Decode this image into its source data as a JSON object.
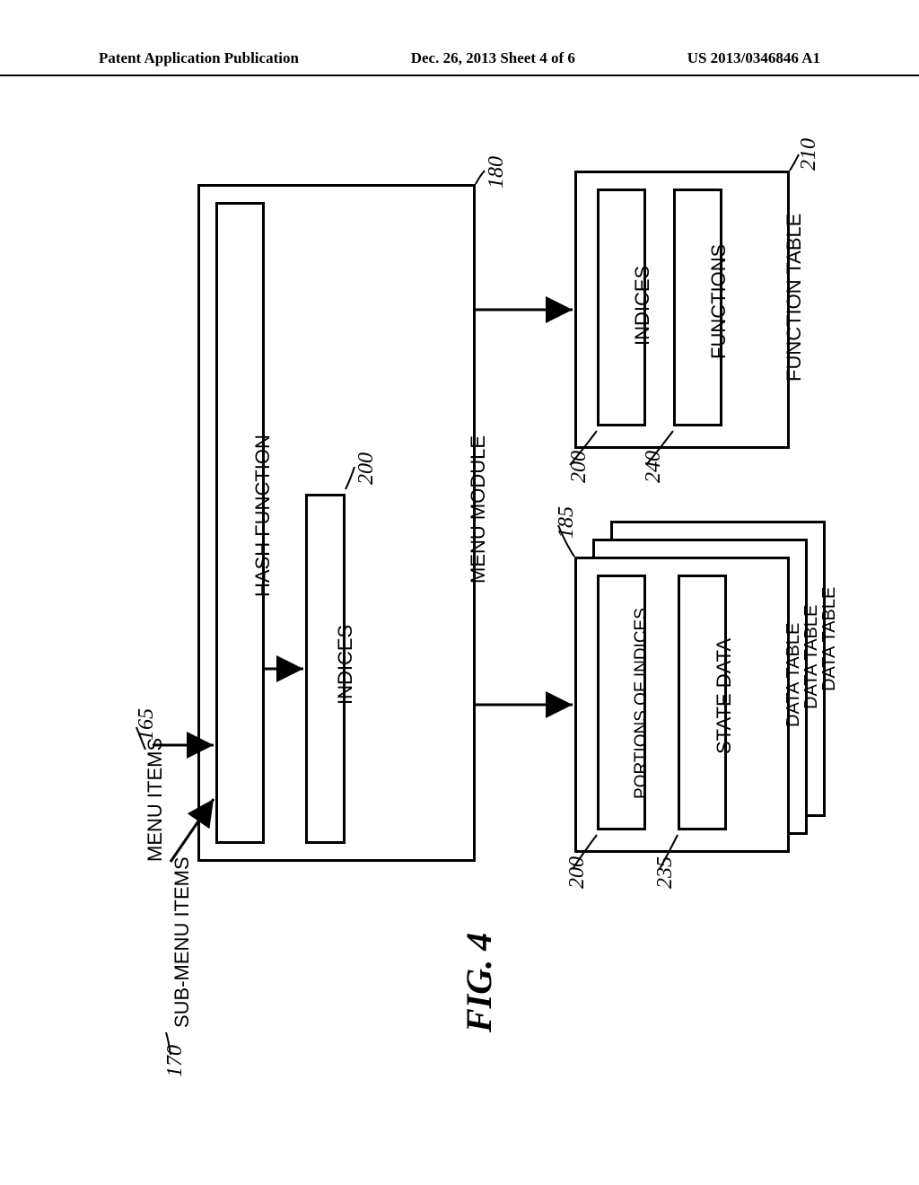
{
  "header": {
    "left": "Patent Application Publication",
    "center": "Dec. 26, 2013  Sheet 4 of 6",
    "right": "US 2013/0346846 A1"
  },
  "labels": {
    "menu_items": "MENU ITEMS",
    "sub_menu_items": "SUB-MENU ITEMS",
    "menu_module": "MENU MODULE",
    "hash_function": "HASH FUNCTION",
    "indices_menu": "INDICES",
    "function_table": "FUNCTION TABLE",
    "ft_indices": "INDICES",
    "ft_functions": "FUNCTIONS",
    "data_table_1": "DATA TABLE",
    "data_table_2": "DATA TABLE",
    "data_table_3": "DATA TABLE",
    "portions_of_indices": "PORTIONS OF INDICES",
    "state_data": "STATE DATA"
  },
  "refs": {
    "r165": "165",
    "r170": "170",
    "r180": "180",
    "r200a": "200",
    "r210": "210",
    "r200b": "200",
    "r240": "240",
    "r185": "185",
    "r200c": "200",
    "r235": "235"
  },
  "figure_caption": "FIG. 4"
}
